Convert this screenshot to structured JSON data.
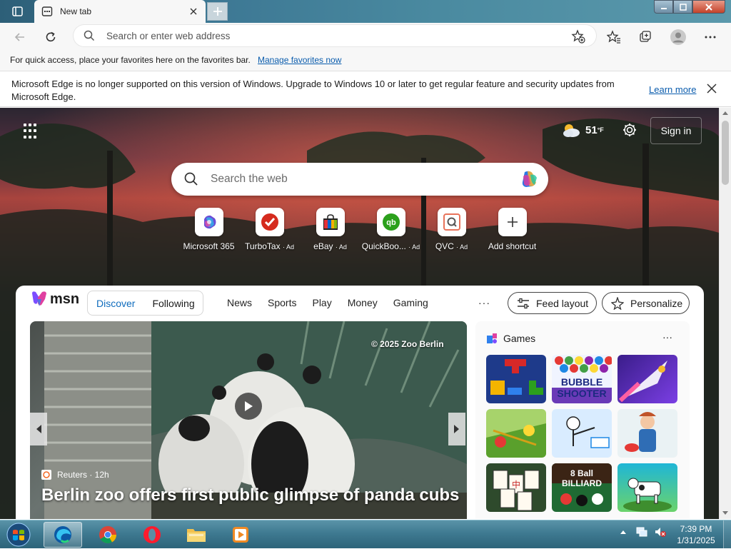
{
  "browser": {
    "tab_title": "New tab",
    "address_placeholder": "Search or enter web address"
  },
  "favorites_bar": {
    "message": "For quick access, place your favorites here on the favorites bar.",
    "link": "Manage favorites now"
  },
  "info_bar": {
    "message": "Microsoft Edge is no longer supported on this version of Windows. Upgrade to Windows 10 or later to get regular feature and security updates from Microsoft Edge.",
    "link": "Learn more"
  },
  "newtab": {
    "weather_temp": "51",
    "weather_unit": "°F",
    "sign_in": "Sign in",
    "search_placeholder": "Search the web",
    "shortcuts": [
      {
        "label": "Microsoft 365",
        "ad": ""
      },
      {
        "label": "TurboTax",
        "ad": "· Ad"
      },
      {
        "label": "eBay",
        "ad": "· Ad"
      },
      {
        "label": "QuickBoo...",
        "ad": "· Ad"
      },
      {
        "label": "QVC",
        "ad": "· Ad"
      },
      {
        "label": "Add shortcut",
        "ad": ""
      }
    ]
  },
  "feed": {
    "logo": "msn",
    "tabs": [
      "Discover",
      "Following"
    ],
    "nav": [
      "News",
      "Sports",
      "Play",
      "Money",
      "Gaming"
    ],
    "more": "···",
    "feed_layout": "Feed layout",
    "personalize": "Personalize",
    "hero": {
      "copyright": "© 2025 Zoo Berlin",
      "source": "Reuters · 12h",
      "headline": "Berlin zoo offers first public glimpse of panda cubs"
    },
    "games": {
      "title": "Games",
      "more": "···",
      "tiles": [
        "BUBBLE SHOOTER",
        "8 Ball BILLIARD"
      ]
    }
  },
  "taskbar": {
    "time": "7:39 PM",
    "date": "1/31/2025"
  },
  "colors": {
    "accent": "#0f6cbd",
    "link": "#0a5cad"
  }
}
